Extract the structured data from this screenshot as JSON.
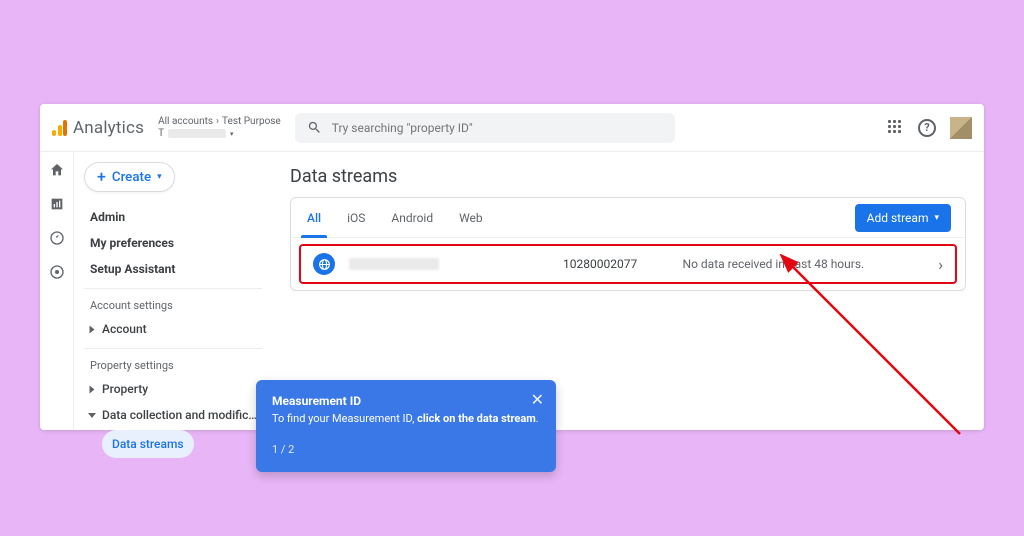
{
  "header": {
    "product": "Analytics",
    "account_path": {
      "accounts": "All accounts",
      "sep": "›",
      "account_name": "Test Purpose"
    },
    "search_placeholder": "Try searching \"property ID\""
  },
  "sidebar": {
    "create_label": "Create",
    "items": {
      "admin": "Admin",
      "my_prefs": "My preferences",
      "setup_asst": "Setup Assistant"
    },
    "account_section": "Account settings",
    "account_item": "Account",
    "property_section": "Property settings",
    "property_item": "Property",
    "dc_item": "Data collection and modifica…",
    "dc_sub": "Data streams"
  },
  "main": {
    "title": "Data streams",
    "tabs": {
      "all": "All",
      "ios": "iOS",
      "android": "Android",
      "web": "Web"
    },
    "add_stream": "Add stream",
    "stream": {
      "id": "10280002077",
      "status": "No data received in past 48 hours."
    }
  },
  "tooltip": {
    "title": "Measurement ID",
    "body_prefix": "To find your Measurement ID, ",
    "body_bold": "click on the data stream",
    "body_suffix": ".",
    "step": "1 / 2"
  }
}
